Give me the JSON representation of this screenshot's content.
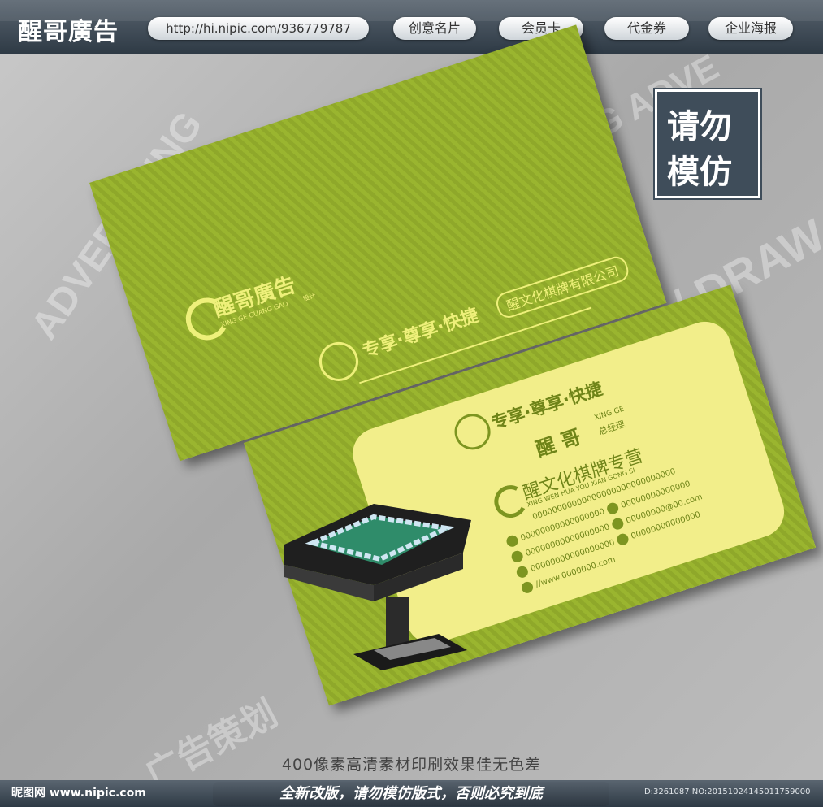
{
  "header": {
    "logo": "醒哥廣告",
    "url": "http://hi.nipic.com/936779787",
    "nav": [
      "创意名片",
      "会员卡",
      "代金券",
      "企业海报"
    ]
  },
  "stamp": {
    "line1": "请勿",
    "line2": "模仿"
  },
  "card_back": {
    "brand": "醒哥廣告",
    "brand_sub": "XING GE GUANG GAO",
    "brand_tag": "设计",
    "slogan": "专享·尊享·快捷",
    "company": "醒文化棋牌有限公司"
  },
  "card_front": {
    "slogan": "专享·尊享·快捷",
    "name": "醒 哥",
    "pinyin": "XING GE",
    "title": "总经理",
    "company": "醒文化棋牌专营",
    "company_pinyin": "XING WEN HUA YOU XIAN GONG SI",
    "contacts_left": [
      "00000000000000000",
      "00000000000000000",
      "00000000000000000",
      "//www.0000000.com"
    ],
    "contacts_right": [
      "00000000000000",
      "00000000@00.com",
      "00000000000000"
    ],
    "address": "00000000000000000000000000000"
  },
  "caption": "400像素高清素材印刷效果佳无色差",
  "footer": {
    "site": "昵图网 www.nipic.com",
    "notice": "全新改版，请勿模仿版式，否则必究到底",
    "id": "ID:3261087 NO:20151024145011759000"
  },
  "colors": {
    "green": "#8fa82a",
    "yellow": "#f2ee8a",
    "bar": "#3f4d5a"
  }
}
